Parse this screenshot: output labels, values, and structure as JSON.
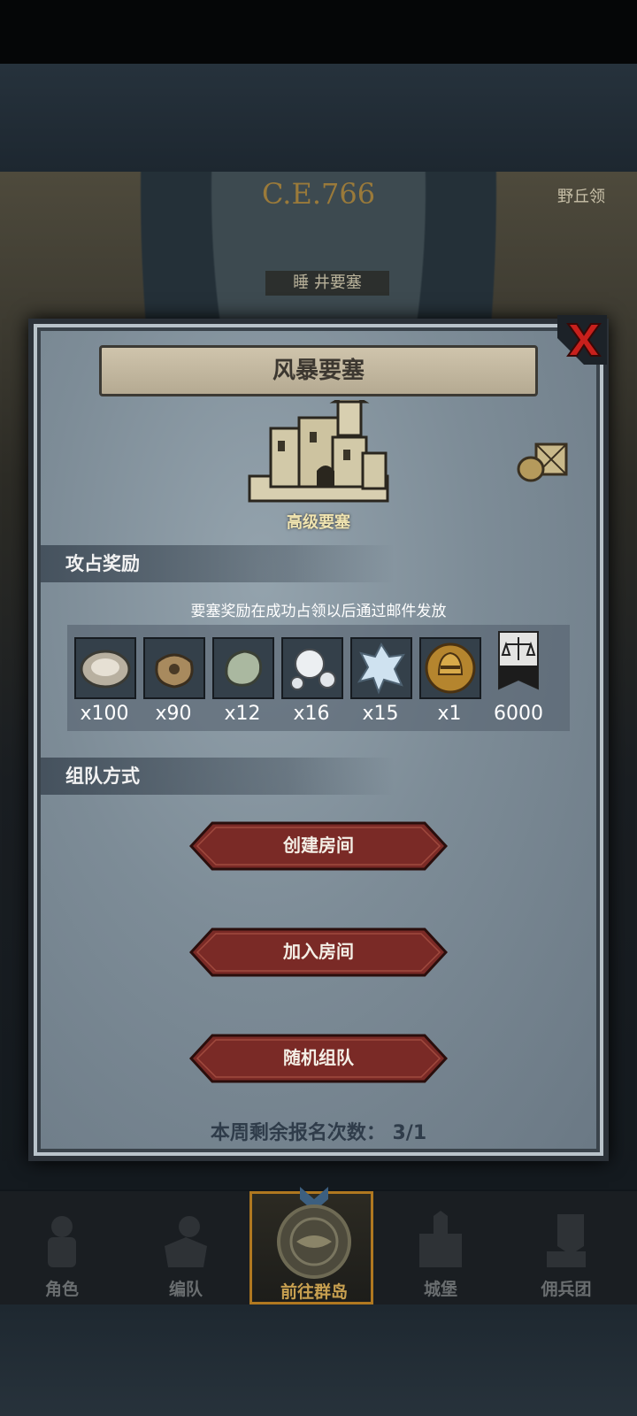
{
  "background": {
    "date": "C.E.766",
    "top_right_tag": "野丘领",
    "fortress_label": "睡 井要塞"
  },
  "modal": {
    "title": "风暴要塞",
    "fortress_grade": "高级要塞",
    "rewards_section": {
      "label": "攻占奖励",
      "note": "要塞奖励在成功占领以后通过邮件发放",
      "items": [
        {
          "icon": "oyster-icon",
          "count": "x100"
        },
        {
          "icon": "sack-icon",
          "count": "x90"
        },
        {
          "icon": "jade-stone-icon",
          "count": "x12"
        },
        {
          "icon": "pearls-icon",
          "count": "x16"
        },
        {
          "icon": "crystal-icon",
          "count": "x15"
        },
        {
          "icon": "knight-helmet-coin-icon",
          "count": "x1"
        },
        {
          "icon": "justice-banner-icon",
          "count": "6000"
        }
      ]
    },
    "team_section": {
      "label": "组队方式",
      "buttons": [
        "创建房间",
        "加入房间",
        "随机组队"
      ]
    },
    "signup_text": "本周剩余报名次数： 3/1"
  },
  "bottom_nav": [
    {
      "label": "角色",
      "icon": "character-icon",
      "active": false
    },
    {
      "label": "编队",
      "icon": "formation-icon",
      "active": false
    },
    {
      "label": "前往群岛",
      "icon": "islands-compass-icon",
      "active": true
    },
    {
      "label": "城堡",
      "icon": "castle-icon",
      "active": false
    },
    {
      "label": "佣兵团",
      "icon": "mercenary-icon",
      "active": false
    }
  ],
  "colors": {
    "accent_gold": "#b07820",
    "button_red": "#7a2a26",
    "modal_bg": "#7d8c97"
  }
}
